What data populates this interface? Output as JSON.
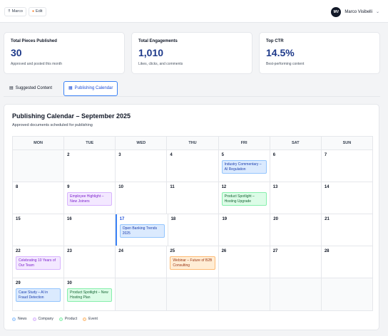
{
  "topbar": {
    "crumbs": [
      {
        "icon": "grid-icon",
        "label": "Marco"
      },
      {
        "icon": "edit-dot-icon",
        "label": "Edit"
      }
    ],
    "user": {
      "initials": "MV",
      "name": "Marco Visibelli"
    }
  },
  "stats": [
    {
      "title": "Total Pieces Published",
      "value": "30",
      "sub": "Approved and posted this month"
    },
    {
      "title": "Total Engagements",
      "value": "1,010",
      "sub": "Likes, clicks, and comments"
    },
    {
      "title": "Top CTR",
      "value": "14.5%",
      "sub": "Best-performing content"
    }
  ],
  "tabs": [
    {
      "label": "Suggested Content",
      "icon": "document-icon",
      "active": false
    },
    {
      "label": "Publishing Calendar",
      "icon": "calendar-icon",
      "active": true
    }
  ],
  "calendar": {
    "title": "Publishing Calendar – September 2025",
    "subtitle": "Approved documents scheduled for publishing",
    "days_of_week": [
      "MON",
      "TUE",
      "WED",
      "THU",
      "FRI",
      "SAT",
      "SUN"
    ],
    "weeks": [
      [
        {
          "day": ""
        },
        {
          "day": "2"
        },
        {
          "day": "3"
        },
        {
          "day": "4"
        },
        {
          "day": "5",
          "events": [
            {
              "label": "Industry Commentary – AI Regulation",
              "type": "news"
            }
          ]
        },
        {
          "day": "6"
        },
        {
          "day": "7"
        }
      ],
      [
        {
          "day": "8"
        },
        {
          "day": "9",
          "events": [
            {
              "label": "Employee Highlight – New Joiners",
              "type": "company"
            }
          ]
        },
        {
          "day": "10"
        },
        {
          "day": "11"
        },
        {
          "day": "12",
          "events": [
            {
              "label": "Product Spotlight – Hosting Upgrade",
              "type": "product"
            }
          ]
        },
        {
          "day": "13"
        },
        {
          "day": "14"
        }
      ],
      [
        {
          "day": "15"
        },
        {
          "day": "16"
        },
        {
          "day": "17",
          "today": true,
          "events": [
            {
              "label": "Open Banking Trends 2025",
              "type": "news"
            }
          ]
        },
        {
          "day": "18"
        },
        {
          "day": "19"
        },
        {
          "day": "20"
        },
        {
          "day": "21"
        }
      ],
      [
        {
          "day": "22",
          "events": [
            {
              "label": "Celebrating 10 Years of Our Team",
              "type": "company"
            }
          ]
        },
        {
          "day": "23"
        },
        {
          "day": "24"
        },
        {
          "day": "25",
          "events": [
            {
              "label": "Webinar – Future of B2B Consulting",
              "type": "event"
            }
          ]
        },
        {
          "day": "26"
        },
        {
          "day": "27"
        },
        {
          "day": "28"
        }
      ],
      [
        {
          "day": "29",
          "events": [
            {
              "label": "Case Study – AI in Fraud Detection",
              "type": "news"
            }
          ]
        },
        {
          "day": "30",
          "events": [
            {
              "label": "Product Spotlight – New Hosting Plan",
              "type": "product"
            }
          ]
        },
        {
          "day": ""
        },
        {
          "day": ""
        },
        {
          "day": ""
        },
        {
          "day": ""
        },
        {
          "day": ""
        }
      ]
    ],
    "legend": [
      {
        "label": "News",
        "type": "news"
      },
      {
        "label": "Company",
        "type": "company"
      },
      {
        "label": "Product",
        "type": "product"
      },
      {
        "label": "Event",
        "type": "event"
      }
    ]
  },
  "colors": {
    "accent": "#3b82f6",
    "stat_value": "#1e3a8a",
    "news": "#dbeafe",
    "company": "#f3e8ff",
    "product": "#dcfce7",
    "event": "#ffedd5"
  }
}
